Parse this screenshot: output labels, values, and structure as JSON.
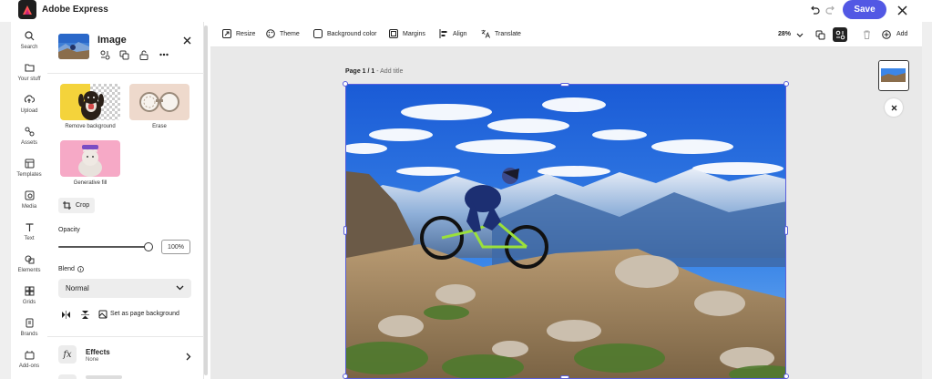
{
  "app": {
    "title": "Adobe Express",
    "save_label": "Save"
  },
  "rail": {
    "items": [
      {
        "label": "Search",
        "icon": "search-icon"
      },
      {
        "label": "Your stuff",
        "icon": "folder-icon"
      },
      {
        "label": "Upload",
        "icon": "upload-icon"
      },
      {
        "label": "Assets",
        "icon": "assets-icon"
      },
      {
        "label": "Templates",
        "icon": "templates-icon"
      },
      {
        "label": "Media",
        "icon": "media-icon"
      },
      {
        "label": "Text",
        "icon": "text-icon"
      },
      {
        "label": "Elements",
        "icon": "elements-icon"
      },
      {
        "label": "Grids",
        "icon": "grids-icon"
      },
      {
        "label": "Brands",
        "icon": "brands-icon"
      },
      {
        "label": "Add-ons",
        "icon": "addons-icon"
      }
    ]
  },
  "panel": {
    "title": "Image",
    "features": [
      {
        "label": "Remove background"
      },
      {
        "label": "Erase"
      },
      {
        "label": "Generative fill"
      }
    ],
    "crop_label": "Crop",
    "opacity_label": "Opacity",
    "opacity_value": "100%",
    "opacity_fraction": 1.0,
    "blend_label": "Blend",
    "blend_value": "Normal",
    "page_bg_label": "Set as page background",
    "effects_title": "Effects",
    "effects_value": "None",
    "effects_icon_text": "fx"
  },
  "toolbar": {
    "tools": [
      {
        "label": "Resize",
        "icon": "resize-icon"
      },
      {
        "label": "Theme",
        "icon": "theme-icon"
      },
      {
        "label": "Background color",
        "icon": "background-color-icon"
      },
      {
        "label": "Margins",
        "icon": "margins-icon"
      },
      {
        "label": "Align",
        "icon": "align-icon"
      },
      {
        "label": "Translate",
        "icon": "translate-icon"
      }
    ],
    "zoom": "28%",
    "add_label": "Add"
  },
  "canvas": {
    "page_label_bold": "Page 1 / 1",
    "page_label_hint": " - Add title"
  },
  "colors": {
    "accent": "#5258e4",
    "selection": "#5a5fdc"
  }
}
